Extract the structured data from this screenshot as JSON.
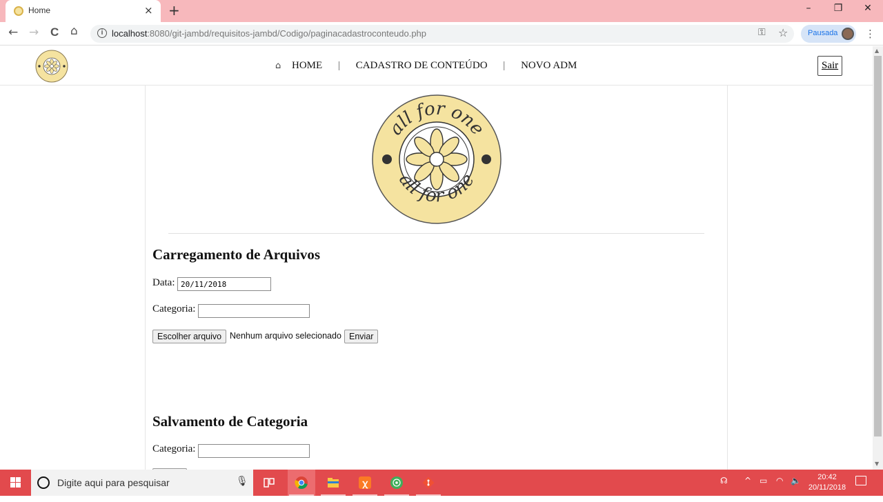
{
  "browser": {
    "tab_title": "Home",
    "tab_close": "×",
    "new_tab": "+",
    "url_host": "localhost",
    "url_path": ":8080/git-jambd/requisitos-jambd/Codigo/paginacadastroconteudo.php",
    "profile_label": "Pausada",
    "window_controls": {
      "minimize": "–",
      "restore": "❐",
      "close": "✕"
    },
    "nav": {
      "back": "←",
      "forward": "→",
      "reload": "C",
      "home": "⌂"
    }
  },
  "site": {
    "nav": {
      "home_label": "HOME",
      "cadastro_label": "CADASTRO DE CONTEÚDO",
      "novo_adm_label": "NOVO ADM",
      "separator": "|"
    },
    "logout_label": "Sair",
    "logo_text": "all for one"
  },
  "upload_section": {
    "title": "Carregamento de Arquivos",
    "date_label": "Data:",
    "date_value": "20/11/2018",
    "category_label": "Categoria:",
    "category_value": "",
    "choose_file_label": "Escolher arquivo",
    "file_status": "Nenhum arquivo selecionado",
    "submit_label": "Enviar"
  },
  "category_section": {
    "title": "Salvamento de Categoria",
    "category_label": "Categoria:",
    "category_value": ""
  },
  "taskbar": {
    "search_placeholder": "Digite aqui para pesquisar",
    "clock_time": "20:42",
    "clock_date": "20/11/2018",
    "apps": [
      "task-view",
      "chrome",
      "file-explorer",
      "xampp",
      "app-flower",
      "git"
    ]
  },
  "colors": {
    "titlebar": "#f7b8bc",
    "taskbar": "#e24a4d",
    "logo_fill": "#f5e3a0",
    "accent": "#1a73e8"
  }
}
